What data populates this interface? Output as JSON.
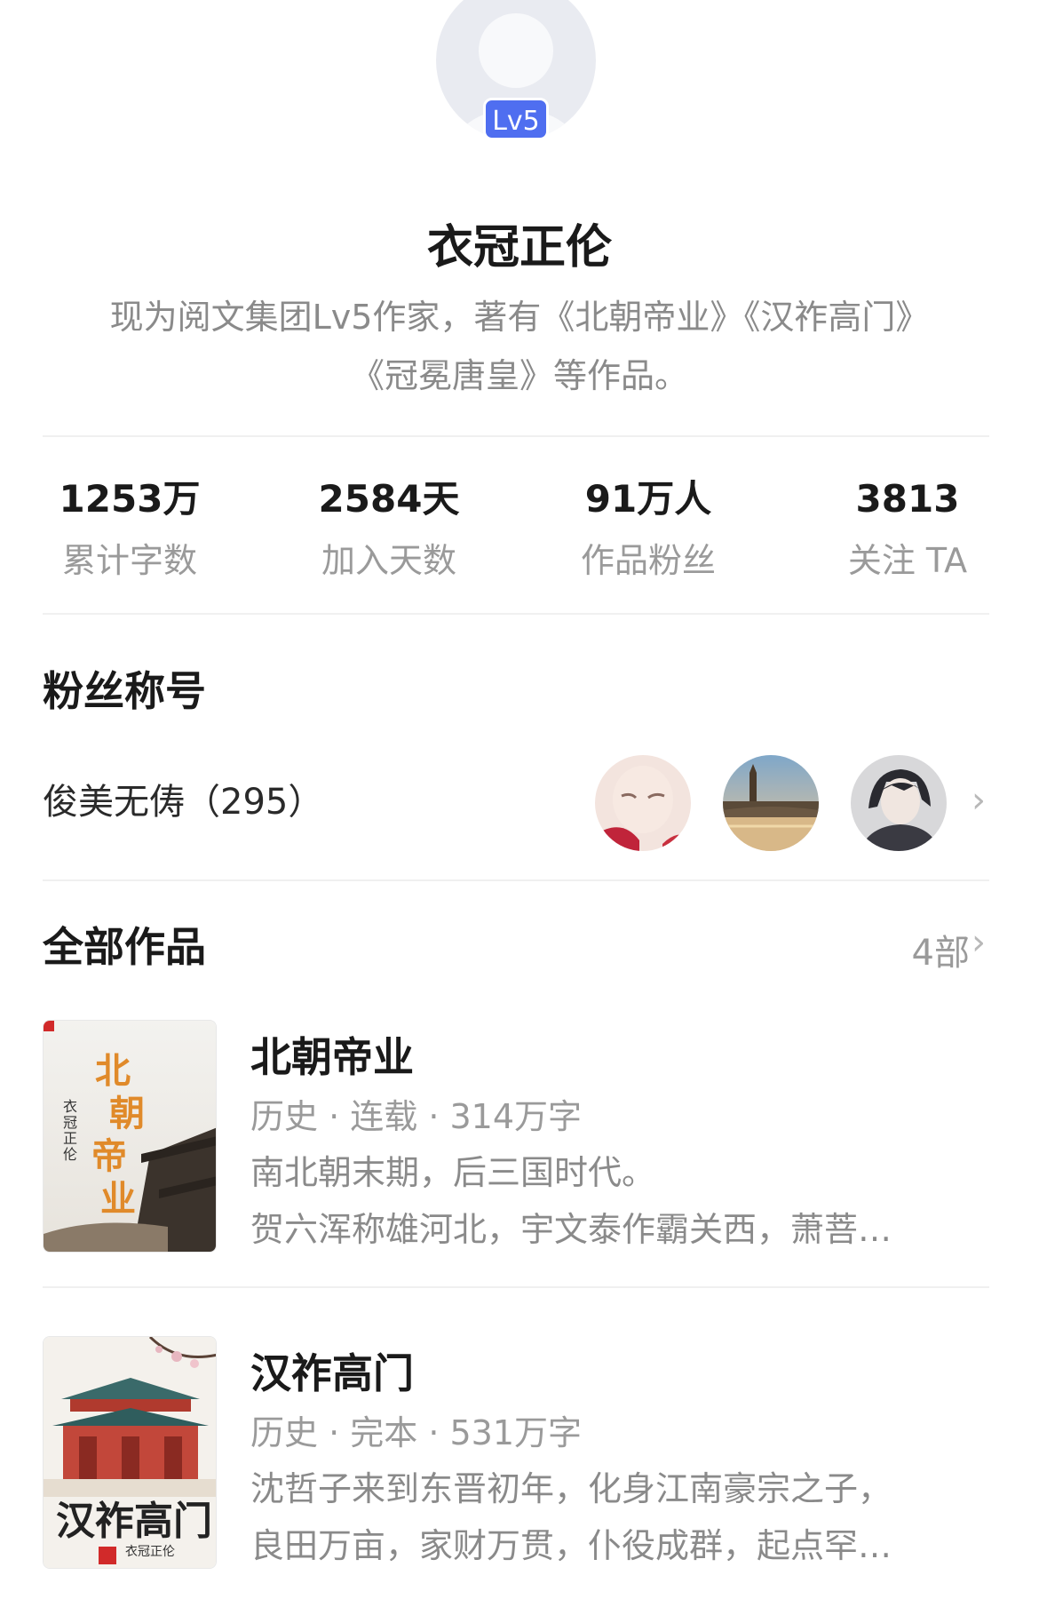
{
  "profile": {
    "level_badge": "Lv5",
    "name": "衣冠正伦",
    "bio_line1": "现为阅文集团Lv5作家，著有《北朝帝业》《汉祚高门》",
    "bio_line2": "《冠冕唐皇》等作品。"
  },
  "stats": [
    {
      "value": "1253万",
      "label": "累计字数"
    },
    {
      "value": "2584天",
      "label": "加入天数"
    },
    {
      "value": "91万人",
      "label": "作品粉丝"
    },
    {
      "value": "3813",
      "label": "关注 TA"
    }
  ],
  "fan_title": {
    "heading": "粉丝称号",
    "name": "俊美无俦（295）"
  },
  "works": {
    "heading": "全部作品",
    "count": "4部",
    "books": [
      {
        "title": "北朝帝业",
        "meta": "历史 · 连载 · 314万字",
        "desc_line1": "南北朝末期，后三国时代。",
        "desc_line2": "贺六浑称雄河北，宇文泰作霸关西，萧菩…",
        "cover_title": "北朝帝业",
        "cover_author": "衣冠正伦"
      },
      {
        "title": "汉祚高门",
        "meta": "历史 · 完本 · 531万字",
        "desc_line1": "沈哲子来到东晋初年，化身江南豪宗之子，",
        "desc_line2": "良田万亩，家财万贯，仆役成群，起点罕…",
        "cover_title": "汉祚高门",
        "cover_author": "衣冠正伦"
      }
    ]
  },
  "colors": {
    "badge": "#4f6ef0",
    "muted_text": "#9a9a9a",
    "cover1_title": "#e08a2a",
    "cover2_title": "#222222"
  }
}
